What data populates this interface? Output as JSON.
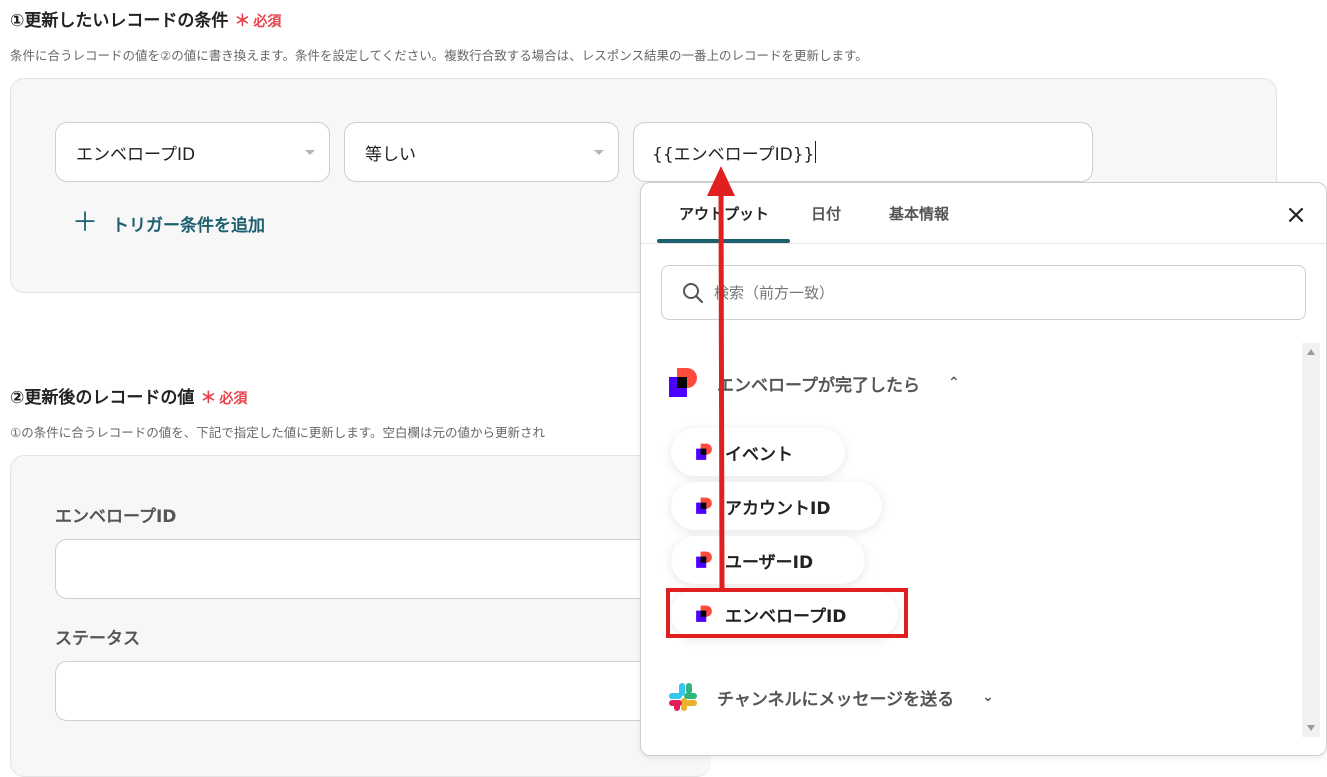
{
  "section1": {
    "title": "①更新したいレコードの条件",
    "required_mark": "＊",
    "required_label": "必須",
    "description": "条件に合うレコードの値を②の値に書き換えます。条件を設定してください。複数行合致する場合は、レスポンス結果の一番上のレコードを更新します。",
    "field_select": "エンベロープID",
    "operator_select": "等しい",
    "value_input": "{{エンベロープID}}",
    "add_trigger_icon": "＋",
    "add_trigger_label": "トリガー条件を追加"
  },
  "section2": {
    "title": "②更新後のレコードの値",
    "required_mark": "＊",
    "required_label": "必須",
    "description": "①の条件に合うレコードの値を、下記で指定した値に更新します。空白欄は元の値から更新され",
    "fields": [
      {
        "label": "エンベロープID",
        "value": ""
      },
      {
        "label": "ステータス",
        "value": ""
      }
    ]
  },
  "popup": {
    "tabs": [
      "アウトプット",
      "日付",
      "基本情報"
    ],
    "active_tab": "アウトプット",
    "close_icon": "×",
    "search_placeholder": "検索（前方一致）",
    "group1": {
      "title": "エンベロープが完了したら",
      "chevron": "⌃",
      "items": [
        "イベント",
        "アカウントID",
        "ユーザーID",
        "エンベロープID"
      ]
    },
    "group2": {
      "title": "チャンネルにメッセージを送る",
      "chevron": "⌄"
    }
  },
  "colors": {
    "accent": "#1c5f6e",
    "required": "#e8424a",
    "highlight_box": "#e02020",
    "arrow": "#e02020"
  }
}
